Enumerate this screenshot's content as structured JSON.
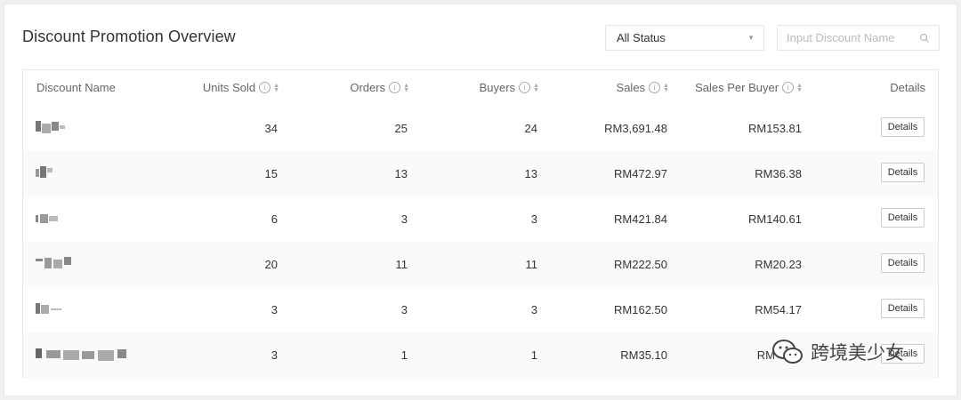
{
  "header": {
    "title": "Discount Promotion Overview"
  },
  "filter": {
    "status_value": "All Status",
    "search_placeholder": "Input Discount Name"
  },
  "table": {
    "columns": [
      "Discount Name",
      "Units Sold",
      "Orders",
      "Buyers",
      "Sales",
      "Sales Per Buyer",
      "Details"
    ],
    "rows": [
      {
        "name": "",
        "units": "34",
        "orders": "25",
        "buyers": "24",
        "sales": "RM3,691.48",
        "spb": "RM153.81",
        "details": "Details"
      },
      {
        "name": "",
        "units": "15",
        "orders": "13",
        "buyers": "13",
        "sales": "RM472.97",
        "spb": "RM36.38",
        "details": "Details"
      },
      {
        "name": "",
        "units": "6",
        "orders": "3",
        "buyers": "3",
        "sales": "RM421.84",
        "spb": "RM140.61",
        "details": "Details"
      },
      {
        "name": "",
        "units": "20",
        "orders": "11",
        "buyers": "11",
        "sales": "RM222.50",
        "spb": "RM20.23",
        "details": "Details"
      },
      {
        "name": "",
        "units": "3",
        "orders": "3",
        "buyers": "3",
        "sales": "RM162.50",
        "spb": "RM54.17",
        "details": "Details"
      },
      {
        "name": "",
        "units": "3",
        "orders": "1",
        "buyers": "1",
        "sales": "RM35.10",
        "spb": "RM",
        "details": "Details"
      }
    ]
  },
  "watermark": {
    "text": "跨境美少女"
  }
}
